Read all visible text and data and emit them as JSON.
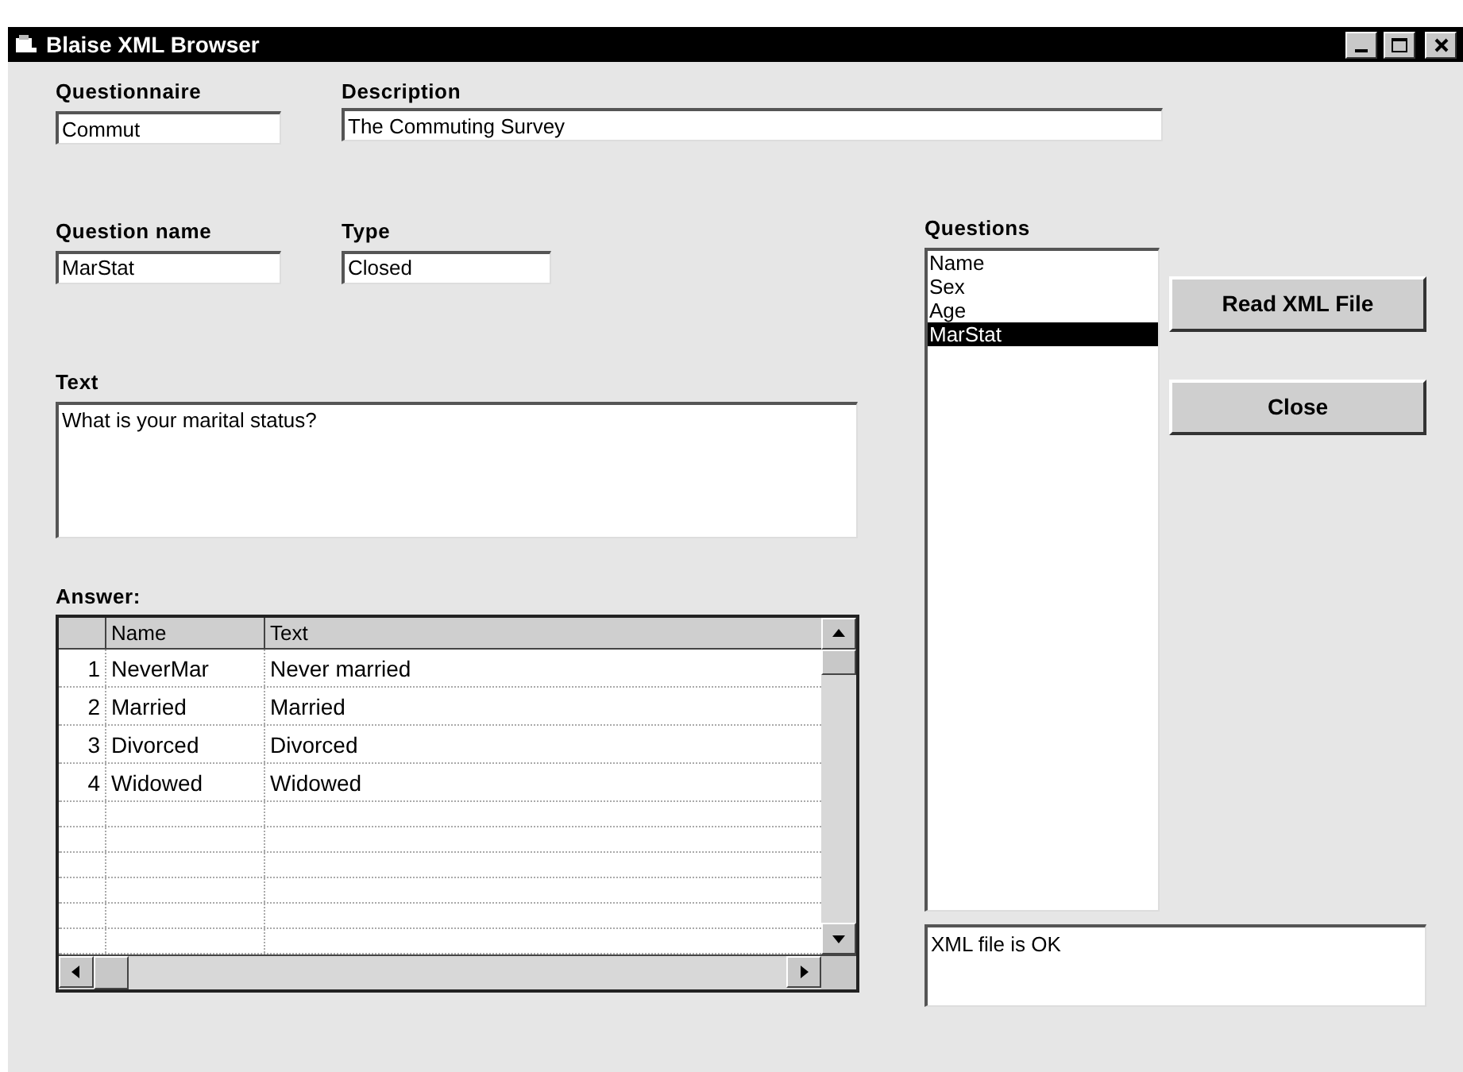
{
  "window": {
    "title": "Blaise XML Browser"
  },
  "questionnaire": {
    "label": "Questionnaire",
    "value": "Commut"
  },
  "description": {
    "label": "Description",
    "value": "The Commuting Survey"
  },
  "question_name": {
    "label": "Question name",
    "value": "MarStat"
  },
  "type": {
    "label": "Type",
    "value": "Closed"
  },
  "text": {
    "label": "Text",
    "value": "What is your marital status?"
  },
  "answer": {
    "label": "Answer:",
    "columns": [
      "Name",
      "Text"
    ],
    "rows": [
      {
        "number": "1",
        "name": "NeverMar",
        "text": "Never married"
      },
      {
        "number": "2",
        "name": "Married",
        "text": "Married"
      },
      {
        "number": "3",
        "name": "Divorced",
        "text": "Divorced"
      },
      {
        "number": "4",
        "name": "Widowed",
        "text": "Widowed"
      }
    ]
  },
  "questions": {
    "label": "Questions",
    "items": [
      {
        "label": "Name",
        "selected": false
      },
      {
        "label": "Sex",
        "selected": false
      },
      {
        "label": "Age",
        "selected": false
      },
      {
        "label": "MarStat",
        "selected": true
      }
    ]
  },
  "buttons": [
    "Read XML File",
    "Close"
  ],
  "status": {
    "value": "XML file is OK"
  }
}
